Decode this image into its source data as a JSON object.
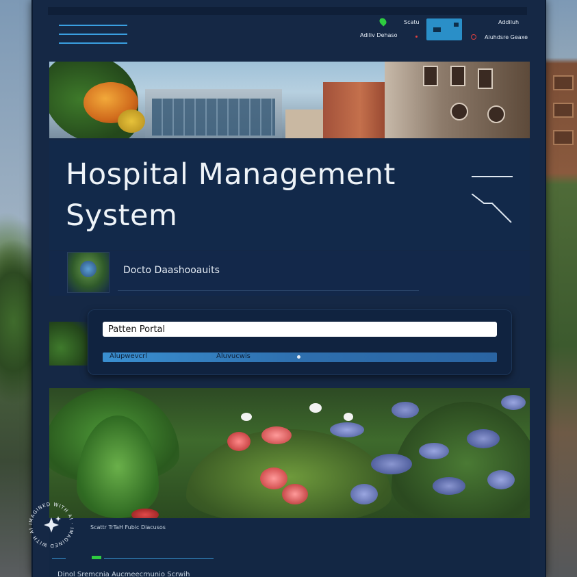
{
  "topbar": {
    "status_label": "Scatu",
    "user_label": "Adiliv Dehaso",
    "right_label_1": "Addiluh",
    "right_label_2": "Aiuhdsre Geaxe"
  },
  "main": {
    "title": "Hospital Management System",
    "doctor_dashboard_label": "Docto Daashooauits"
  },
  "patient_portal": {
    "input_value": "Patten Portal",
    "bar_label_1": "Alupwevcrl",
    "bar_label_2": "Aluvucwis"
  },
  "footer": {
    "links": "Scattr TrTaH   Fubic Diacusos",
    "bottom_text": "Dinol Sremcnia Aucmeecrnunio Scrwih"
  },
  "watermark": {
    "text": "IMAGINED WITH AI · IMAGINED WITH AI ·"
  },
  "colors": {
    "panel_bg": "#152845",
    "accent_blue": "#3a9fe0",
    "status_green": "#2ecc40",
    "alert_red": "#e04040"
  },
  "icons": [
    "hamburger-menu-icon",
    "location-pin-icon",
    "notification-card-icon",
    "sparkle-icon"
  ]
}
